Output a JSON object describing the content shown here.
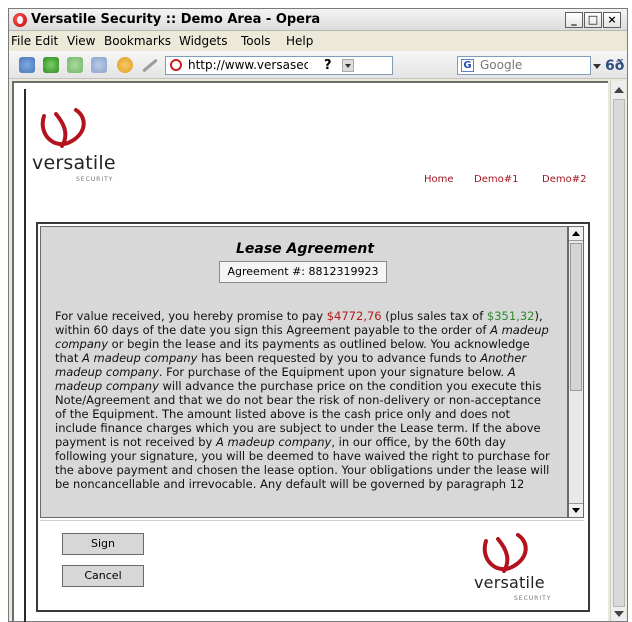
{
  "window": {
    "title": "Versatile Security :: Demo Area - Opera"
  },
  "menu": {
    "items": [
      "File",
      "Edit",
      "View",
      "Bookmarks",
      "Widgets",
      "Tools",
      "Help"
    ]
  },
  "toolbar": {
    "address_url": "http://www.versasec.com/",
    "help_label": "?",
    "search_provider": "Google",
    "zoom_label": "6ð"
  },
  "site": {
    "logo_word": "versatile",
    "logo_sub": "SECURITY",
    "nav": [
      "Home",
      "Demo#1",
      "Demo#2"
    ]
  },
  "agreement": {
    "title": "Lease Agreement",
    "number_label": "Agreement #: 8812319923",
    "body": {
      "p1": "For value received, you hereby promise to pay ",
      "price": "$4772,76",
      "p2": " (plus sales tax of ",
      "tax": "$351,32",
      "p3": "), within 60 days of the date you sign this Agreement payable to the order of ",
      "company_a1": "A madeup company",
      "p4": " or begin the lease and its payments as outlined below. You acknowledge that ",
      "company_a2": "A madeup company",
      "p5": " has been requested by you to advance funds to ",
      "company_b": "Another madeup company",
      "p6": ". For purchase of the Equipment upon your signature below. ",
      "company_a3": "A madeup company",
      "p7": " will advance the purchase price on the condition you execute this Note/Agreement and that we do not bear the risk of non-delivery or non-acceptance of the Equipment. The amount listed above is the cash price only and does not include finance charges which you are subject to under the Lease term. If the above payment is not received by ",
      "company_a4": "A madeup company",
      "p8": ", in our office, by the 60th day following your signature, you will be deemed to have waived the right to purchase for the above payment and chosen the lease option. Your obligations under the lease will be noncancellable and irrevocable. Any default will be governed by paragraph 12"
    }
  },
  "buttons": {
    "sign": "Sign",
    "cancel": "Cancel"
  },
  "colors": {
    "brand_red": "#a4161f",
    "price_red": "#b31b1b",
    "tax_green": "#2e8b2e"
  }
}
